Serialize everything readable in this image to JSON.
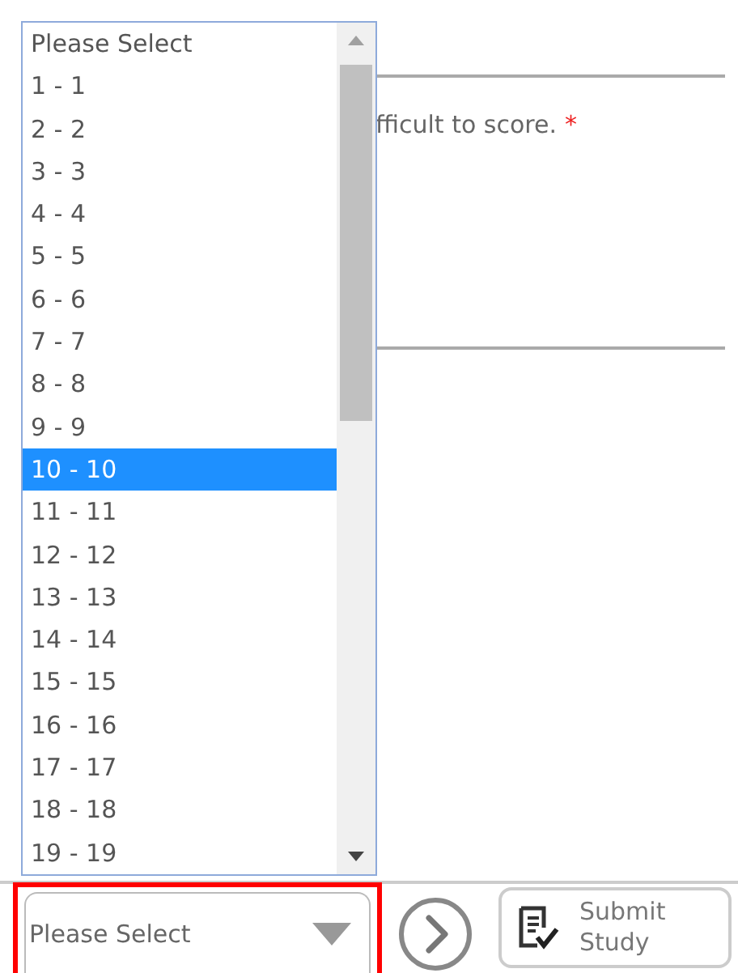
{
  "question": {
    "text": "fficult to score.",
    "required_mark": "*"
  },
  "dropdown_list": {
    "options": [
      {
        "label": "Please Select",
        "selected": false
      },
      {
        "label": "1 - 1",
        "selected": false
      },
      {
        "label": "2 - 2",
        "selected": false
      },
      {
        "label": "3 - 3",
        "selected": false
      },
      {
        "label": "4 - 4",
        "selected": false
      },
      {
        "label": "5 - 5",
        "selected": false
      },
      {
        "label": "6 - 6",
        "selected": false
      },
      {
        "label": "7 - 7",
        "selected": false
      },
      {
        "label": "8 - 8",
        "selected": false
      },
      {
        "label": "9 - 9",
        "selected": false
      },
      {
        "label": "10 - 10",
        "selected": true
      },
      {
        "label": "11 - 11",
        "selected": false
      },
      {
        "label": "12 - 12",
        "selected": false
      },
      {
        "label": "13 - 13",
        "selected": false
      },
      {
        "label": "14 - 14",
        "selected": false
      },
      {
        "label": "15 - 15",
        "selected": false
      },
      {
        "label": "16 - 16",
        "selected": false
      },
      {
        "label": "17 - 17",
        "selected": false
      },
      {
        "label": "18 - 18",
        "selected": false
      },
      {
        "label": "19 - 19",
        "selected": false
      }
    ]
  },
  "footer": {
    "select": {
      "value": "Please Select",
      "highlighted": true
    },
    "submit_button": {
      "label": "Submit Study"
    }
  }
}
